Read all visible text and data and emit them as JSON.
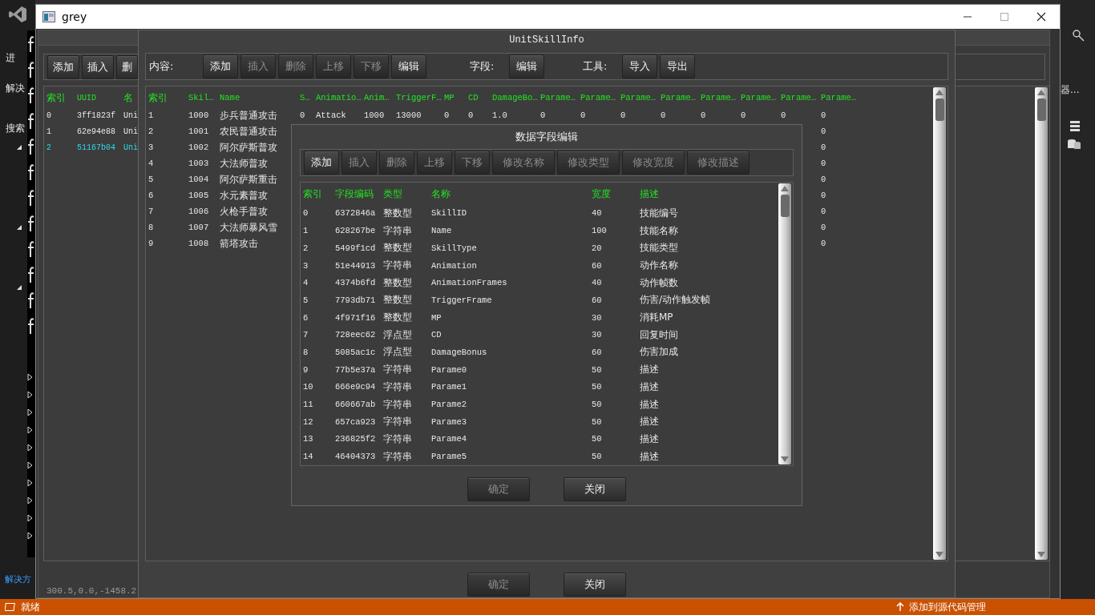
{
  "ide": {
    "left_labels": [
      "进",
      "解决",
      "搜索"
    ],
    "solution_tab": "解决方",
    "right_label": "器...",
    "status": "就绪",
    "source_control": "添加到源代码管理"
  },
  "window": {
    "title": "grey"
  },
  "main_panel": {
    "toolbar": [
      {
        "label": "添加",
        "disabled": false
      },
      {
        "label": "插入",
        "disabled": false
      },
      {
        "label": "删",
        "disabled": false
      }
    ],
    "columns": [
      "索引",
      "UUID",
      "名"
    ],
    "rows": [
      {
        "cells": [
          "0",
          "3ff1823f",
          "Uni"
        ],
        "selected": false
      },
      {
        "cells": [
          "1",
          "62e94e88",
          "Uni"
        ],
        "selected": false
      },
      {
        "cells": [
          "2",
          "51167b04",
          "Uni"
        ],
        "selected": true
      }
    ],
    "status_text": "300.5,0.0,-1458.2"
  },
  "unit_skill_info": {
    "title": "UnitSkillInfo",
    "content_label": "内容:",
    "content_buttons": [
      {
        "label": "添加",
        "disabled": false
      },
      {
        "label": "插入",
        "disabled": true
      },
      {
        "label": "删除",
        "disabled": true
      },
      {
        "label": "上移",
        "disabled": true
      },
      {
        "label": "下移",
        "disabled": true
      },
      {
        "label": "编辑",
        "disabled": false
      }
    ],
    "field_label": "字段:",
    "field_buttons": [
      {
        "label": "编辑",
        "disabled": false
      }
    ],
    "tools_label": "工具:",
    "tool_buttons": [
      {
        "label": "导入",
        "disabled": false
      },
      {
        "label": "导出",
        "disabled": false
      }
    ],
    "table": {
      "columns": [
        "索引",
        "Skil…",
        "Name",
        "S…",
        "Animatio…",
        "Anim…",
        "TriggerF…",
        "MP",
        "CD",
        "DamageBo…",
        "Parame…",
        "Parame…",
        "Parame…",
        "Parame…",
        "Parame…",
        "Parame…",
        "Parame…",
        "Parame…"
      ],
      "rows": [
        {
          "cells": [
            "1",
            "1000",
            "步兵普通攻击",
            "0",
            "Attack",
            "1000",
            "13000",
            "0",
            "0",
            "1.0",
            "0",
            "0",
            "0",
            "0",
            "0",
            "0",
            "0",
            "0"
          ]
        },
        {
          "cells": [
            "2",
            "1001",
            "农民普通攻击",
            null,
            null,
            null,
            null,
            null,
            null,
            null,
            null,
            null,
            null,
            null,
            null,
            null,
            null,
            "0"
          ]
        },
        {
          "cells": [
            "3",
            "1002",
            "阿尔萨斯普攻",
            null,
            null,
            null,
            null,
            null,
            null,
            null,
            null,
            null,
            null,
            null,
            null,
            null,
            null,
            "0"
          ]
        },
        {
          "cells": [
            "4",
            "1003",
            "大法师普攻",
            null,
            null,
            null,
            null,
            null,
            null,
            null,
            null,
            null,
            null,
            null,
            null,
            null,
            null,
            "0"
          ]
        },
        {
          "cells": [
            "5",
            "1004",
            "阿尔萨斯重击",
            null,
            null,
            null,
            null,
            null,
            null,
            null,
            null,
            null,
            null,
            null,
            null,
            null,
            null,
            "0"
          ]
        },
        {
          "cells": [
            "6",
            "1005",
            "水元素普攻",
            null,
            null,
            null,
            null,
            null,
            null,
            null,
            null,
            null,
            null,
            null,
            null,
            null,
            null,
            "0"
          ]
        },
        {
          "cells": [
            "7",
            "1006",
            "火枪手普攻",
            null,
            null,
            null,
            null,
            null,
            null,
            null,
            null,
            null,
            null,
            null,
            null,
            null,
            null,
            "0"
          ]
        },
        {
          "cells": [
            "8",
            "1007",
            "大法师暴风雪",
            null,
            null,
            null,
            null,
            null,
            null,
            null,
            null,
            null,
            null,
            null,
            null,
            null,
            null,
            "0"
          ]
        },
        {
          "cells": [
            "9",
            "1008",
            "箭塔攻击",
            null,
            null,
            null,
            null,
            null,
            null,
            null,
            null,
            null,
            null,
            null,
            null,
            null,
            null,
            "0"
          ]
        }
      ]
    },
    "buttons": [
      {
        "label": "确定",
        "disabled": true
      },
      {
        "label": "关闭",
        "disabled": false
      }
    ]
  },
  "field_editor": {
    "title": "数据字段编辑",
    "toolbar": [
      {
        "label": "添加",
        "disabled": false
      },
      {
        "label": "插入",
        "disabled": true
      },
      {
        "label": "删除",
        "disabled": true
      },
      {
        "label": "上移",
        "disabled": true
      },
      {
        "label": "下移",
        "disabled": true
      },
      {
        "label": "修改名称",
        "disabled": true
      },
      {
        "label": "修改类型",
        "disabled": true
      },
      {
        "label": "修改宽度",
        "disabled": true
      },
      {
        "label": "修改描述",
        "disabled": true
      }
    ],
    "table": {
      "columns": [
        "索引",
        "字段编码",
        "类型",
        "名称",
        "宽度",
        "描述"
      ],
      "rows": [
        {
          "cells": [
            "0",
            "6372846a",
            "整数型",
            "SkillID",
            "40",
            "技能编号"
          ]
        },
        {
          "cells": [
            "1",
            "628267be",
            "字符串",
            "Name",
            "100",
            "技能名称"
          ]
        },
        {
          "cells": [
            "2",
            "5499f1cd",
            "整数型",
            "SkillType",
            "20",
            "技能类型"
          ]
        },
        {
          "cells": [
            "3",
            "51e44913",
            "字符串",
            "Animation",
            "60",
            "动作名称"
          ]
        },
        {
          "cells": [
            "4",
            "4374b6fd",
            "整数型",
            "AnimationFrames",
            "40",
            "动作帧数"
          ]
        },
        {
          "cells": [
            "5",
            "7793db71",
            "整数型",
            "TriggerFrame",
            "60",
            "伤害/动作触发帧"
          ]
        },
        {
          "cells": [
            "6",
            "4f971f16",
            "整数型",
            "MP",
            "30",
            "消耗MP"
          ]
        },
        {
          "cells": [
            "7",
            "728eec62",
            "浮点型",
            "CD",
            "30",
            "回复时间"
          ]
        },
        {
          "cells": [
            "8",
            "5085ac1c",
            "浮点型",
            "DamageBonus",
            "60",
            "伤害加成"
          ]
        },
        {
          "cells": [
            "9",
            "77b5e37a",
            "字符串",
            "Parame0",
            "50",
            "描述"
          ]
        },
        {
          "cells": [
            "10",
            "666e9c94",
            "字符串",
            "Parame1",
            "50",
            "描述"
          ]
        },
        {
          "cells": [
            "11",
            "660667ab",
            "字符串",
            "Parame2",
            "50",
            "描述"
          ]
        },
        {
          "cells": [
            "12",
            "657ca923",
            "字符串",
            "Parame3",
            "50",
            "描述"
          ]
        },
        {
          "cells": [
            "13",
            "236825f2",
            "字符串",
            "Parame4",
            "50",
            "描述"
          ]
        },
        {
          "cells": [
            "14",
            "46404373",
            "字符串",
            "Parame5",
            "50",
            "描述"
          ]
        }
      ]
    },
    "buttons": [
      {
        "label": "确定",
        "disabled": true
      },
      {
        "label": "关闭",
        "disabled": false
      }
    ]
  }
}
